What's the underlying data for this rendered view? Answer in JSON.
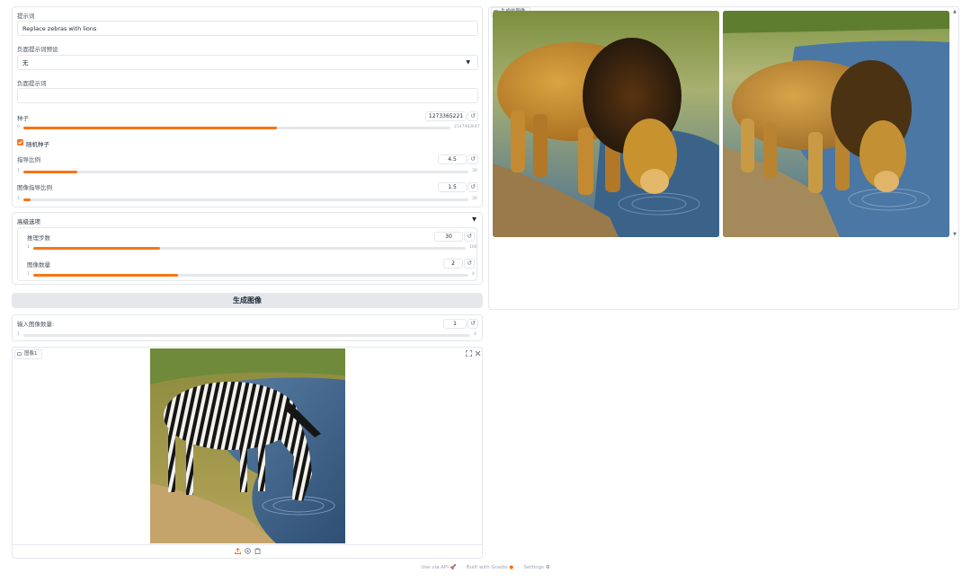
{
  "prompt": {
    "label": "提示词",
    "value": "Replace zebras with lions"
  },
  "negative_preset": {
    "label": "负面提示词预设",
    "value": "无"
  },
  "negative_prompt": {
    "label": "负面提示词",
    "value": ""
  },
  "seed": {
    "label": "种子",
    "value": "1273365221",
    "min": "0",
    "max": "2147483647",
    "fill_fraction": 0.593
  },
  "random_seed": {
    "label": "随机种子",
    "checked": true
  },
  "guidance": {
    "label": "指导比例",
    "value": "4.5",
    "min": "1",
    "max": "30",
    "fill_fraction": 0.121
  },
  "image_guidance": {
    "label": "图像指导比例",
    "value": "1.5",
    "min": "1",
    "max": "30",
    "fill_fraction": 0.017
  },
  "advanced": {
    "title": "高级选项",
    "toggle_icon": "▼",
    "steps": {
      "label": "推理步数",
      "value": "30",
      "min": "1",
      "max": "100",
      "fill_fraction": 0.293
    },
    "num_images": {
      "label": "图像数量",
      "value": "2",
      "min": "1",
      "max": "4",
      "fill_fraction": 0.333
    }
  },
  "generate_button": {
    "label": "生成图像"
  },
  "input_count": {
    "label": "输入图像数量:",
    "value": "1",
    "min": "1",
    "max": "4",
    "fill_fraction": 0.0
  },
  "input_image": {
    "label": "图像1",
    "alt": "zebra drinking water"
  },
  "output_gallery": {
    "label": "生成的图像",
    "images": [
      "lion drinking 1",
      "lion drinking 2"
    ]
  },
  "footer": {
    "api": "Use via API",
    "sep": "·",
    "built": "Built with Gradio",
    "settings": "Settings"
  },
  "colors": {
    "accent": "#f97316",
    "border": "#e5e7eb",
    "button_bg": "#e5e7eb"
  }
}
